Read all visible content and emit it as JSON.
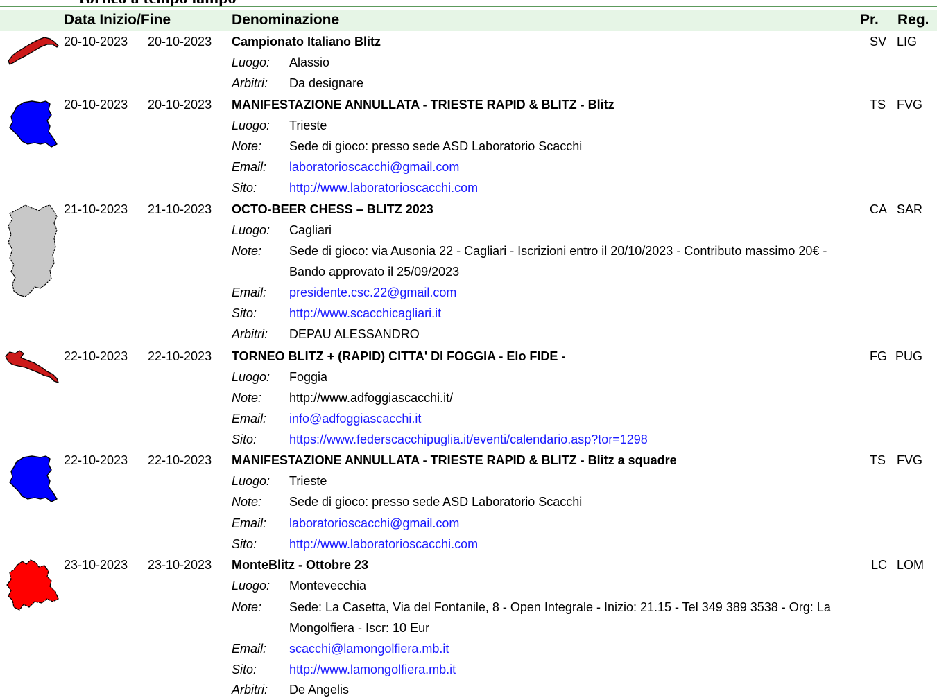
{
  "page": {
    "partial_title": "Torneo a tempo lampo"
  },
  "header": {
    "date_col": "Data Inizio/Fine",
    "name_col": "Denominazione",
    "prov_col": "Pr.",
    "reg_col": "Reg."
  },
  "labels": {
    "luogo": "Luogo:",
    "note": "Note:",
    "email": "Email:",
    "sito": "Sito:",
    "arbitri": "Arbitri:"
  },
  "colors": {
    "header_bg": "#e6f5e6",
    "link": "#1a1aff",
    "liguria": "#cc1a1a",
    "fvg": "#0000ff",
    "sardegna": "#c8c8c8",
    "puglia": "#cc1a1a",
    "lombardia": "#ff0000"
  },
  "events": [
    {
      "start": "20-10-2023",
      "end": "20-10-2023",
      "title": "Campionato Italiano Blitz",
      "prov": "SV",
      "reg": "LIG",
      "region_icon": "liguria-map-icon",
      "luogo": "Alassio",
      "arbitri": "Da designare"
    },
    {
      "start": "20-10-2023",
      "end": "20-10-2023",
      "title": "MANIFESTAZIONE ANNULLATA - TRIESTE RAPID & BLITZ - Blitz",
      "prov": "TS",
      "reg": "FVG",
      "region_icon": "friuli-venezia-giulia-map-icon",
      "luogo": "Trieste",
      "note": "Sede di gioco: presso sede ASD Laboratorio Scacchi",
      "email": "laboratorioscacchi@gmail.com",
      "sito": "http://www.laboratorioscacchi.com"
    },
    {
      "start": "21-10-2023",
      "end": "21-10-2023",
      "title": "OCTO-BEER CHESS – BLITZ 2023",
      "prov": "CA",
      "reg": "SAR",
      "region_icon": "sardegna-map-icon",
      "luogo": "Cagliari",
      "note_1": "Sede di gioco: via Ausonia 22 - Cagliari - Iscrizioni entro il 20/10/2023 - Contributo massimo 20€ -",
      "note_2": "Bando approvato il 25/09/2023",
      "email": "presidente.csc.22@gmail.com",
      "sito": "http://www.scacchicagliari.it",
      "arbitri": "DEPAU ALESSANDRO"
    },
    {
      "start": "22-10-2023",
      "end": "22-10-2023",
      "title": "TORNEO  BLITZ + (RAPID) CITTA' DI FOGGIA - Elo FIDE  -",
      "prov": "FG",
      "reg": "PUG",
      "region_icon": "puglia-map-icon",
      "luogo": "Foggia",
      "note": "http://www.adfoggiascacchi.it/",
      "email": "info@adfoggiascacchi.it",
      "sito": "https://www.federscacchipuglia.it/eventi/calendario.asp?tor=1298"
    },
    {
      "start": "22-10-2023",
      "end": "22-10-2023",
      "title": "MANIFESTAZIONE ANNULLATA - TRIESTE RAPID & BLITZ - Blitz a squadre",
      "prov": "TS",
      "reg": "FVG",
      "region_icon": "friuli-venezia-giulia-map-icon",
      "luogo": "Trieste",
      "note": "Sede di gioco: presso sede ASD Laboratorio Scacchi",
      "email": "laboratorioscacchi@gmail.com",
      "sito": "http://www.laboratorioscacchi.com"
    },
    {
      "start": "23-10-2023",
      "end": "23-10-2023",
      "title": "MonteBlitz - Ottobre 23",
      "prov": "LC",
      "reg": "LOM",
      "region_icon": "lombardia-map-icon",
      "luogo": "Montevecchia",
      "note_1": "Sede: La Casetta, Via del Fontanile, 8 - Open Integrale - Inizio: 21.15 - Tel 349 389 3538 - Org: La",
      "note_2": "Mongolfiera - Iscr: 10 Eur",
      "email": "scacchi@lamongolfiera.mb.it",
      "sito": "http://www.lamongolfiera.mb.it",
      "arbitri": "De Angelis"
    }
  ]
}
